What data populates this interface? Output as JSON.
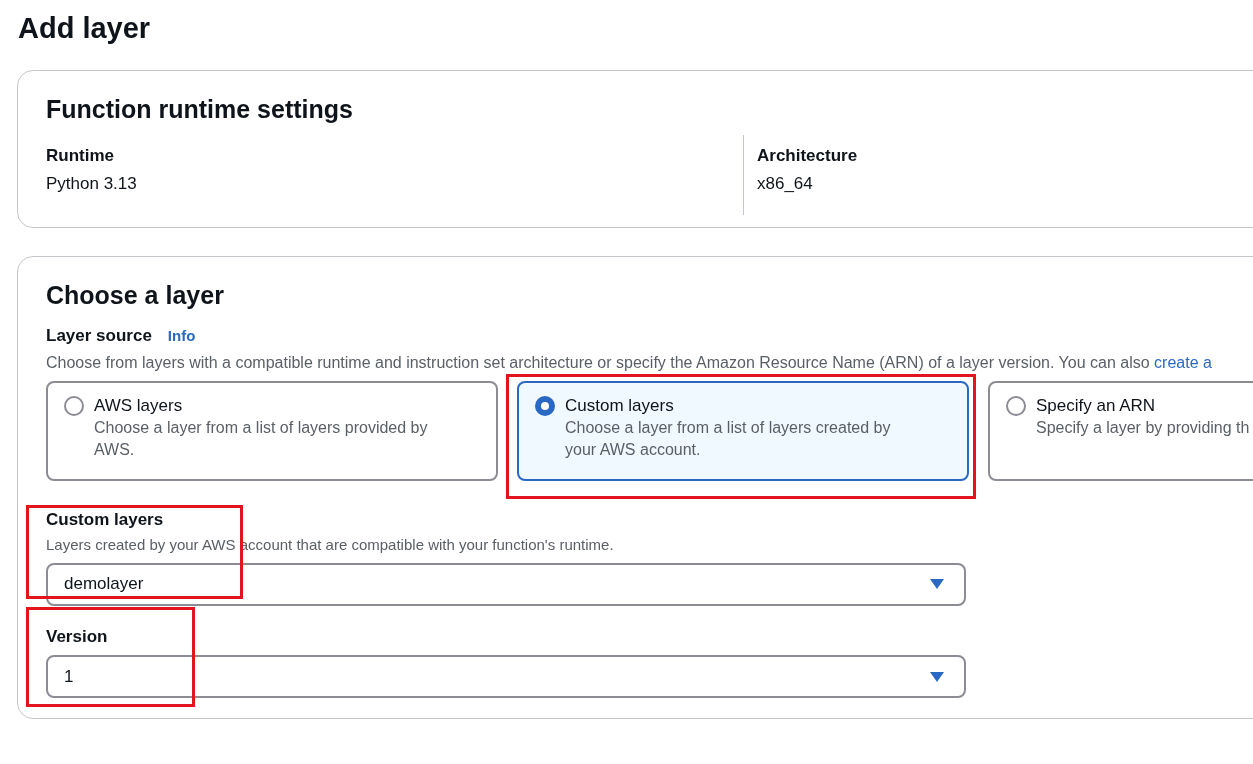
{
  "page_title": "Add layer",
  "runtime_settings": {
    "title": "Function runtime settings",
    "fields": [
      {
        "label": "Runtime",
        "value": "Python 3.13"
      },
      {
        "label": "Architecture",
        "value": "x86_64"
      }
    ]
  },
  "choose_layer": {
    "title": "Choose a layer",
    "layer_source": {
      "label": "Layer source",
      "info": "Info",
      "description": "Choose from layers with a compatible runtime and instruction set architecture or specify the Amazon Resource Name (ARN) of a layer version. You can also ",
      "link": "create a",
      "options": [
        {
          "title": "AWS layers",
          "description": "Choose a layer from a list of layers provided by AWS.",
          "selected": false
        },
        {
          "title": "Custom layers",
          "description": "Choose a layer from a list of layers created by your AWS account.",
          "selected": true
        },
        {
          "title": "Specify an ARN",
          "description": "Specify a layer by providing th",
          "selected": false
        }
      ]
    },
    "custom_layers": {
      "label": "Custom layers",
      "description": "Layers created by your AWS account that are compatible with your function's runtime.",
      "value": "demolayer"
    },
    "version": {
      "label": "Version",
      "value": "1"
    }
  }
}
